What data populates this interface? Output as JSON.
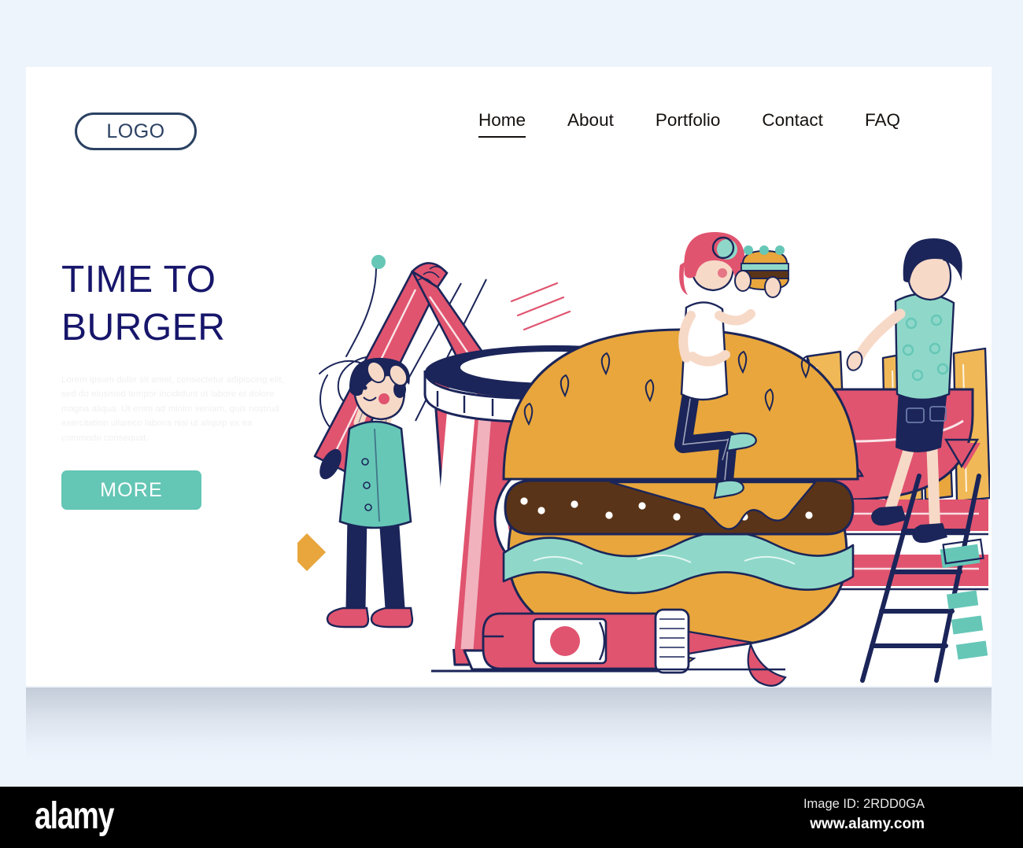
{
  "page": {
    "background_color": "#eef4fc",
    "card_color": "#ffffff"
  },
  "header": {
    "logo_label": "LOGO",
    "nav": [
      {
        "label": "Home",
        "active": true
      },
      {
        "label": "About",
        "active": false
      },
      {
        "label": "Portfolio",
        "active": false
      },
      {
        "label": "Contact",
        "active": false
      },
      {
        "label": "FAQ",
        "active": false
      }
    ]
  },
  "hero": {
    "headline": "TIME TO\nBURGER",
    "headline_ghost": "TIME TO",
    "headline_color": "#17166b",
    "paragraph": "Lorem ipsum dolor sit amet, consectetur adipiscing elit, sed do eiusmod tempor incididunt ut labore et dolore magna aliqua. Ut enim ad minim veniam, quis nostrud exercitation ullamco laboris nisi ut aliquip ex ea commodo consequat.",
    "cta_label": "MORE",
    "cta_color": "#64c6b5"
  },
  "illustration": {
    "title": "fast food landing page illustration",
    "palette": {
      "pink": "#e0546f",
      "pink_light": "#f2d6da",
      "navy": "#1b2559",
      "teal": "#66c7b7",
      "teal_light": "#8fd8c9",
      "orange": "#e8a63c",
      "orange_light": "#f0b856",
      "brown": "#5a3418",
      "white": "#ffffff",
      "skin": "#f7d9c7"
    },
    "objects": [
      "soda-cup",
      "bent-straw",
      "burger",
      "french-fries",
      "ketchup-bottle",
      "ladder",
      "man-lifting-straw",
      "woman-eating-burger",
      "man-on-ladder"
    ]
  },
  "footer": {
    "brand": "alamy",
    "image_id": "Image ID: 2RDD0GA",
    "url": "www.alamy.com",
    "background_color": "#000000"
  }
}
